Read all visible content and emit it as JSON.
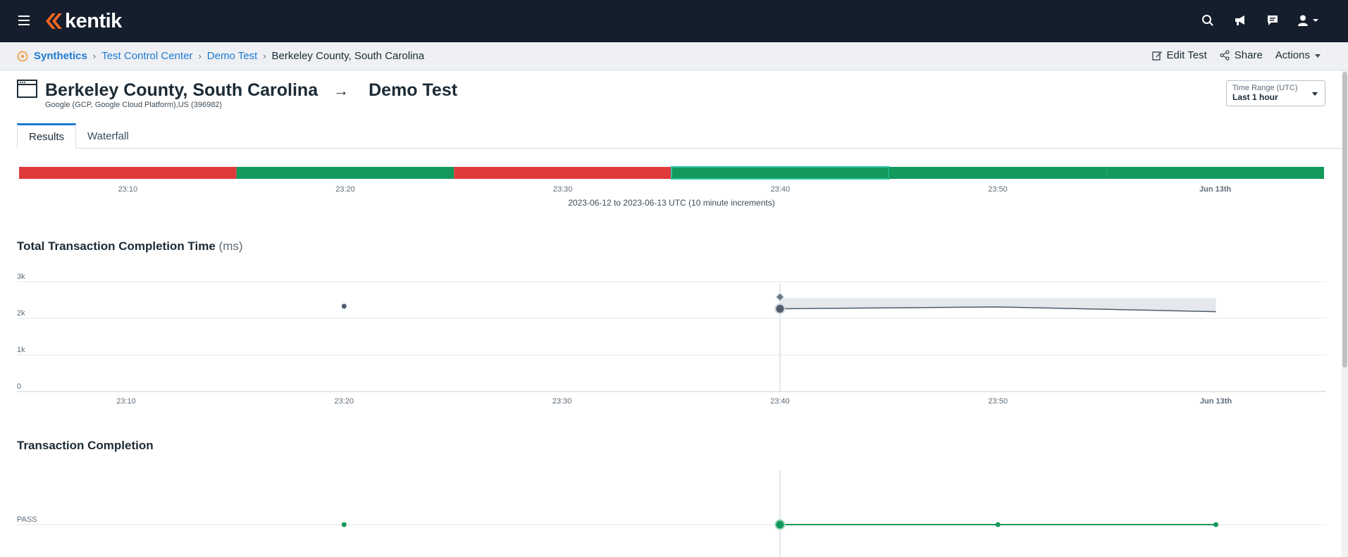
{
  "topbar": {
    "logo_text": "kentik",
    "brand_color": "#f26522",
    "icons": [
      "menu-icon",
      "search-icon",
      "announcement-icon",
      "chat-icon",
      "user-icon"
    ]
  },
  "breadcrumb": {
    "items": [
      "Synthetics",
      "Test Control Center",
      "Demo Test"
    ],
    "current": "Berkeley County, South Carolina"
  },
  "actions": {
    "edit": "Edit Test",
    "share": "Share",
    "actions": "Actions"
  },
  "header": {
    "agent": "Berkeley County, South Carolina",
    "arrow": "→",
    "test": "Demo Test",
    "subtitle": "Google (GCP, Google Cloud Platform),US (396982)"
  },
  "time_range": {
    "label": "Time Range (UTC)",
    "value": "Last 1 hour"
  },
  "tabs": [
    "Results",
    "Waterfall"
  ],
  "status_bar": {
    "segments": [
      "fail",
      "pass",
      "fail",
      "pass-selected",
      "pass",
      "pass"
    ],
    "colors": {
      "fail": "#e03b3b",
      "pass": "#12995b",
      "selected_border": "#2ec4a6"
    },
    "ticks": [
      "23:10",
      "23:20",
      "23:30",
      "23:40",
      "23:50",
      "Jun 13th"
    ],
    "caption": "2023-06-12 to 2023-06-13 UTC (10 minute increments)"
  },
  "chart_data": [
    {
      "type": "line",
      "title": "Total Transaction Completion Time",
      "unit": "(ms)",
      "x": [
        "23:20",
        "23:40",
        "23:50",
        "Jun 13th"
      ],
      "series": [
        {
          "values": [
            2330,
            2260,
            2310,
            2180
          ]
        }
      ],
      "band": {
        "x": [
          "23:40",
          "Jun 13th"
        ],
        "upper": 2550
      },
      "marker": {
        "x": "23:40",
        "value": 2580
      },
      "x_ticks": [
        "23:10",
        "23:20",
        "23:30",
        "23:40",
        "23:50",
        "Jun 13th"
      ],
      "y_ticks": [
        "0",
        "1k",
        "2k",
        "3k"
      ],
      "ylim": [
        0,
        3000
      ]
    },
    {
      "type": "line",
      "title": "Transaction Completion",
      "x": [
        "23:20",
        "23:40",
        "23:50",
        "Jun 13th"
      ],
      "series": [
        {
          "values": [
            "PASS",
            "PASS",
            "PASS",
            "PASS"
          ]
        }
      ],
      "y_ticks": [
        "PASS"
      ]
    }
  ]
}
